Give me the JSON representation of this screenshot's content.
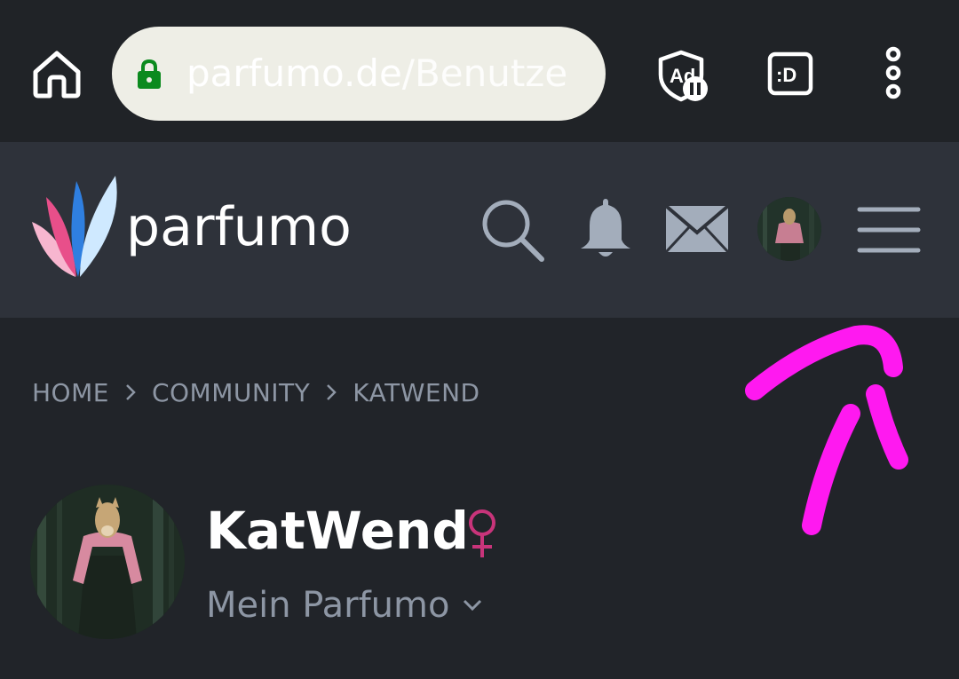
{
  "browser": {
    "url_domain": "parfumo.de",
    "url_path": "/Benutze",
    "icons": [
      "home-icon",
      "lock-icon",
      "adblock-icon",
      "d-extension-icon",
      "menu-dots-icon"
    ]
  },
  "site": {
    "logo_text": "parfumo",
    "icons": [
      "search-icon",
      "bell-icon",
      "mail-icon",
      "avatar",
      "hamburger-icon"
    ]
  },
  "breadcrumb": {
    "items": [
      "HOME",
      "COMMUNITY",
      "KATWEND"
    ]
  },
  "profile": {
    "name": "KatWend",
    "gender_symbol": "♀",
    "menu_label": "Mein Parfumo"
  },
  "colors": {
    "accent_pink": "#c8347a",
    "annotation_magenta": "#ff19f0",
    "url_lock_green": "#0b8a1e"
  }
}
